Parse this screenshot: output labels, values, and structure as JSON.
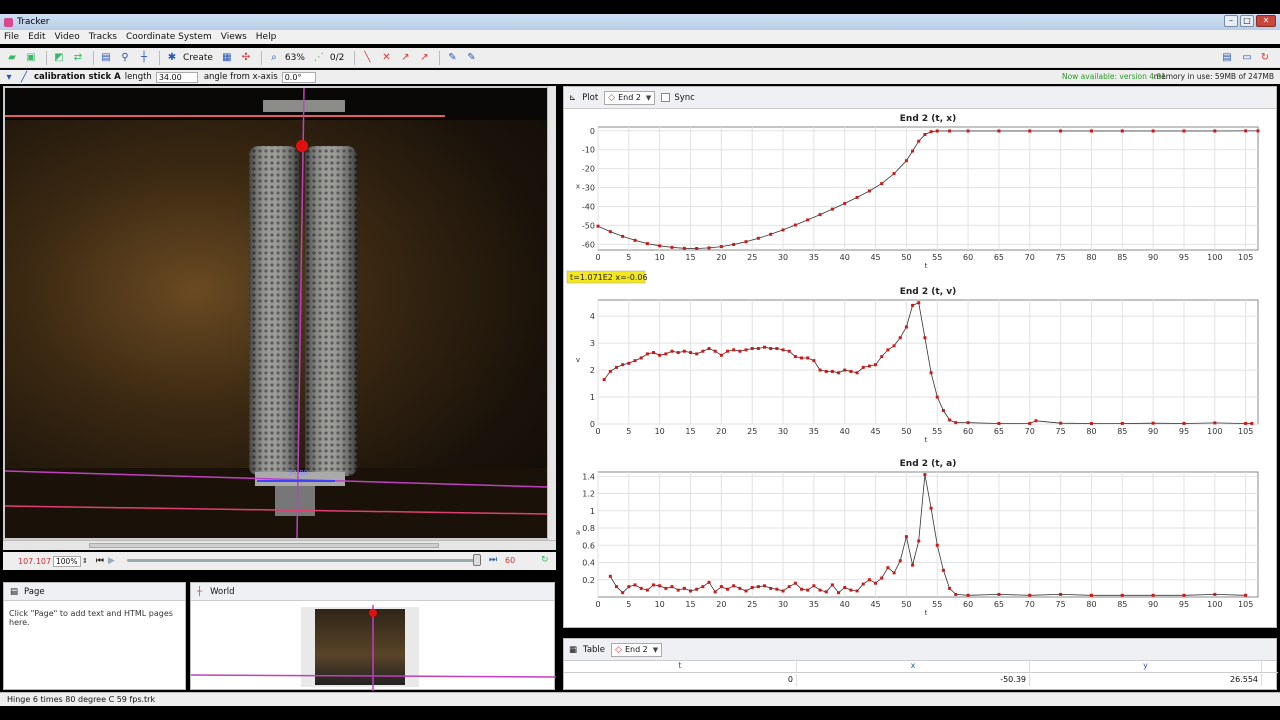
{
  "app": {
    "title": "Tracker"
  },
  "window_controls": {
    "minimize": "–",
    "maximize": "□",
    "close": "✕"
  },
  "menu": [
    "File",
    "Edit",
    "Video",
    "Tracks",
    "Coordinate System",
    "Views",
    "Help"
  ],
  "toolbar": {
    "create_label": "Create",
    "zoom_label": "63%",
    "counter_label": "0/2"
  },
  "calibration": {
    "track_name": "calibration stick A",
    "length_label": "length",
    "length_value": "34.00",
    "angle_label": "angle from x-axis",
    "angle_value": "0.0°",
    "version_note": "Now available: version 4.91",
    "memory_note": "memory in use: 59MB of 247MB"
  },
  "video": {
    "calibration_value": "34.00",
    "colors": {
      "axis": "#c040c0",
      "calib": "#e04070",
      "marker": "#e01010",
      "stick": "#4040ff"
    }
  },
  "player": {
    "frame_time": "107.107",
    "zoom": "100%",
    "end_frame": "60"
  },
  "page_panel": {
    "title": "Page",
    "hint": "Click \"Page\" to add text and HTML pages here."
  },
  "world_panel": {
    "title": "World"
  },
  "status": {
    "file": "Hinge 6 times 80 degree C 59 fps.trk"
  },
  "plot_panel": {
    "plot_label": "Plot",
    "track": "End 2",
    "sync_label": "Sync"
  },
  "table_panel": {
    "label": "Table",
    "track": "End 2",
    "columns": [
      "t",
      "x",
      "y"
    ],
    "row": [
      "0",
      "-50.39",
      "26.554"
    ]
  },
  "readout": "t=1.071E2  x=-0.06",
  "chart_data": [
    {
      "type": "line",
      "title": "End 2 (t, x)",
      "xlabel": "t",
      "ylabel": "x",
      "xlim": [
        0,
        107
      ],
      "ylim": [
        -63,
        2
      ],
      "xticks": [
        0,
        5,
        10,
        15,
        20,
        25,
        30,
        35,
        40,
        45,
        50,
        55,
        60,
        65,
        70,
        75,
        80,
        85,
        90,
        95,
        100,
        105
      ],
      "yticks": [
        0,
        -10,
        -20,
        -30,
        -40,
        -50,
        -60
      ],
      "x": [
        0,
        2,
        4,
        6,
        8,
        10,
        12,
        14,
        16,
        18,
        20,
        22,
        24,
        26,
        28,
        30,
        32,
        34,
        36,
        38,
        40,
        42,
        44,
        46,
        48,
        50,
        51,
        52,
        53,
        54,
        55,
        57,
        60,
        65,
        70,
        75,
        80,
        85,
        90,
        95,
        100,
        105,
        107
      ],
      "y": [
        -50.4,
        -53.3,
        -55.8,
        -57.9,
        -59.6,
        -60.8,
        -61.6,
        -62.1,
        -62.2,
        -61.9,
        -61.2,
        -60.1,
        -58.6,
        -56.8,
        -54.7,
        -52.4,
        -49.8,
        -47.1,
        -44.3,
        -41.4,
        -38.4,
        -35.2,
        -31.8,
        -27.9,
        -22.6,
        -15.8,
        -10.7,
        -5.5,
        -2.0,
        -0.5,
        -0.1,
        -0.1,
        -0.1,
        -0.1,
        -0.1,
        -0.1,
        -0.1,
        -0.1,
        -0.1,
        -0.1,
        -0.1,
        -0.06,
        -0.06
      ]
    },
    {
      "type": "line",
      "title": "End 2 (t, v)",
      "xlabel": "t",
      "ylabel": "v",
      "xlim": [
        0,
        107
      ],
      "ylim": [
        0,
        4.6
      ],
      "xticks": [
        0,
        5,
        10,
        15,
        20,
        25,
        30,
        35,
        40,
        45,
        50,
        55,
        60,
        65,
        70,
        75,
        80,
        85,
        90,
        95,
        100,
        105
      ],
      "yticks": [
        0,
        1,
        2,
        3,
        4
      ],
      "x": [
        1,
        2,
        3,
        4,
        5,
        6,
        7,
        8,
        9,
        10,
        11,
        12,
        13,
        14,
        15,
        16,
        17,
        18,
        19,
        20,
        21,
        22,
        23,
        24,
        25,
        26,
        27,
        28,
        29,
        30,
        31,
        32,
        33,
        34,
        35,
        36,
        37,
        38,
        39,
        40,
        41,
        42,
        43,
        44,
        45,
        46,
        47,
        48,
        49,
        50,
        51,
        52,
        53,
        54,
        55,
        56,
        57,
        58,
        60,
        65,
        70,
        71,
        75,
        80,
        85,
        90,
        95,
        100,
        105,
        106
      ],
      "y": [
        1.65,
        1.95,
        2.1,
        2.2,
        2.25,
        2.35,
        2.45,
        2.6,
        2.65,
        2.55,
        2.6,
        2.7,
        2.65,
        2.7,
        2.65,
        2.6,
        2.7,
        2.8,
        2.7,
        2.55,
        2.7,
        2.75,
        2.7,
        2.75,
        2.8,
        2.8,
        2.85,
        2.8,
        2.8,
        2.75,
        2.7,
        2.5,
        2.45,
        2.45,
        2.35,
        2.0,
        1.95,
        1.95,
        1.9,
        2.0,
        1.95,
        1.9,
        2.1,
        2.15,
        2.2,
        2.5,
        2.75,
        2.9,
        3.2,
        3.6,
        4.4,
        4.5,
        3.2,
        1.9,
        1.0,
        0.5,
        0.15,
        0.05,
        0.05,
        0.02,
        0.02,
        0.12,
        0.03,
        0.02,
        0.02,
        0.03,
        0.02,
        0.04,
        0.02,
        0.02
      ]
    },
    {
      "type": "line",
      "title": "End 2 (t, a)",
      "xlabel": "t",
      "ylabel": "a",
      "xlim": [
        0,
        107
      ],
      "ylim": [
        0,
        1.45
      ],
      "xticks": [
        0,
        5,
        10,
        15,
        20,
        25,
        30,
        35,
        40,
        45,
        50,
        55,
        60,
        65,
        70,
        75,
        80,
        85,
        90,
        95,
        100,
        105
      ],
      "yticks": [
        0.2,
        0.4,
        0.6,
        0.8,
        1.0,
        1.2,
        1.4
      ],
      "x": [
        2,
        3,
        4,
        5,
        6,
        7,
        8,
        9,
        10,
        11,
        12,
        13,
        14,
        15,
        16,
        17,
        18,
        19,
        20,
        21,
        22,
        23,
        24,
        25,
        26,
        27,
        28,
        29,
        30,
        31,
        32,
        33,
        34,
        35,
        36,
        37,
        38,
        39,
        40,
        41,
        42,
        43,
        44,
        45,
        46,
        47,
        48,
        49,
        50,
        51,
        52,
        53,
        54,
        55,
        56,
        57,
        58,
        60,
        65,
        70,
        75,
        80,
        85,
        90,
        95,
        100,
        105
      ],
      "y": [
        0.24,
        0.12,
        0.05,
        0.12,
        0.14,
        0.1,
        0.08,
        0.14,
        0.13,
        0.1,
        0.12,
        0.08,
        0.1,
        0.07,
        0.09,
        0.12,
        0.17,
        0.06,
        0.12,
        0.09,
        0.13,
        0.1,
        0.07,
        0.11,
        0.12,
        0.13,
        0.1,
        0.09,
        0.07,
        0.12,
        0.16,
        0.09,
        0.08,
        0.13,
        0.08,
        0.06,
        0.14,
        0.05,
        0.11,
        0.08,
        0.07,
        0.15,
        0.2,
        0.16,
        0.22,
        0.34,
        0.28,
        0.42,
        0.7,
        0.37,
        0.65,
        1.42,
        1.03,
        0.6,
        0.31,
        0.1,
        0.03,
        0.02,
        0.03,
        0.02,
        0.03,
        0.02,
        0.02,
        0.02,
        0.02,
        0.03,
        0.02
      ]
    }
  ]
}
